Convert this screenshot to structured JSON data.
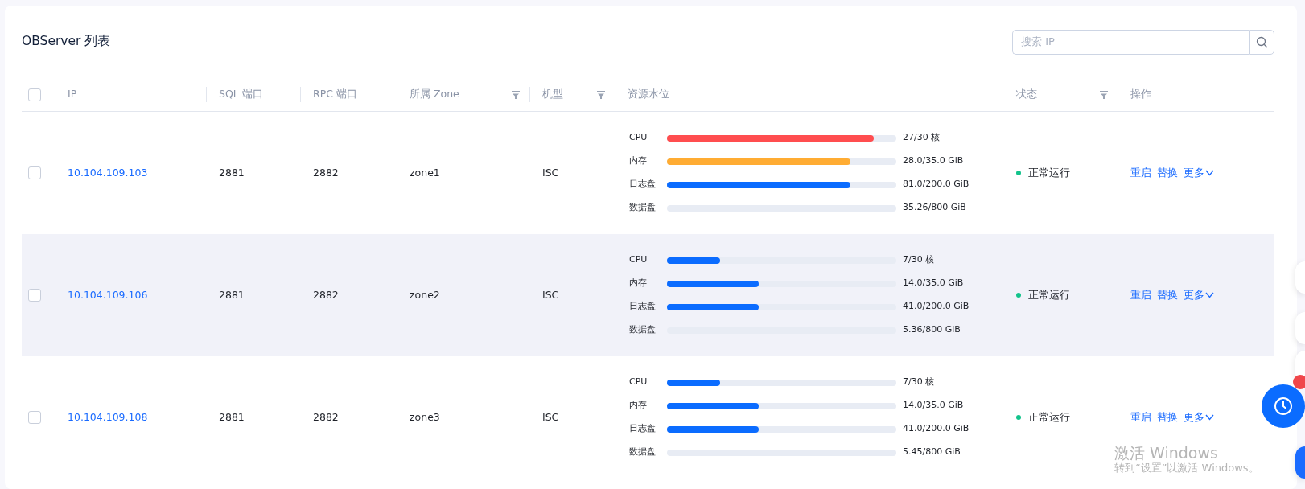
{
  "title": "OBServer 列表",
  "search": {
    "placeholder": "搜索 IP"
  },
  "header_checkbox": {
    "checked": false
  },
  "columns": [
    {
      "label": "IP"
    },
    {
      "label": "SQL 端口"
    },
    {
      "label": "RPC 端口"
    },
    {
      "label": "所属 Zone",
      "filter": true
    },
    {
      "label": "机型",
      "filter": true
    },
    {
      "label": "资源水位"
    },
    {
      "label": "状态",
      "filter": true
    },
    {
      "label": "操作"
    }
  ],
  "rows": [
    {
      "checked": false,
      "hovered": false,
      "ip": "10.104.109.103",
      "sql_port": "2881",
      "rpc_port": "2882",
      "zone": "zone1",
      "model": "ISC",
      "resources": [
        {
          "label": "CPU",
          "level": 0.9,
          "color": "#ff4d4f",
          "reading": "27/30 核"
        },
        {
          "label": "内存",
          "level": 0.8,
          "color": "#ffac33",
          "reading": "28.0/35.0 GiB"
        },
        {
          "label": "日志盘",
          "level": 0.8,
          "color": "#0b6cff",
          "reading": "81.0/200.0 GiB"
        },
        {
          "label": "数据盘",
          "reading": "35.26/800 GiB"
        }
      ],
      "status": "正常运行",
      "actions": [
        "重启",
        "替换",
        "更多"
      ]
    },
    {
      "checked": false,
      "hovered": true,
      "ip": "10.104.109.106",
      "sql_port": "2881",
      "rpc_port": "2882",
      "zone": "zone2",
      "model": "ISC",
      "resources": [
        {
          "label": "CPU",
          "level": 0.23,
          "color": "#0b6cff",
          "reading": "7/30 核"
        },
        {
          "label": "内存",
          "level": 0.4,
          "color": "#0b6cff",
          "reading": "14.0/35.0 GiB"
        },
        {
          "label": "日志盘",
          "level": 0.4,
          "color": "#0b6cff",
          "reading": "41.0/200.0 GiB"
        },
        {
          "label": "数据盘",
          "reading": "5.36/800 GiB"
        }
      ],
      "status": "正常运行",
      "actions": [
        "重启",
        "替换",
        "更多"
      ]
    },
    {
      "checked": false,
      "hovered": false,
      "ip": "10.104.109.108",
      "sql_port": "2881",
      "rpc_port": "2882",
      "zone": "zone3",
      "model": "ISC",
      "resources": [
        {
          "label": "CPU",
          "level": 0.23,
          "color": "#0b6cff",
          "reading": "7/30 核"
        },
        {
          "label": "内存",
          "level": 0.4,
          "color": "#0b6cff",
          "reading": "14.0/35.0 GiB"
        },
        {
          "label": "日志盘",
          "level": 0.4,
          "color": "#0b6cff",
          "reading": "41.0/200.0 GiB"
        },
        {
          "label": "数据盘",
          "reading": "5.45/800 GiB"
        }
      ],
      "status": "正常运行",
      "actions": [
        "重启",
        "替换",
        "更多"
      ]
    }
  ],
  "os_notice": {
    "title": "激活 Windows",
    "text": "转到“设置”以激活 Windows。"
  }
}
